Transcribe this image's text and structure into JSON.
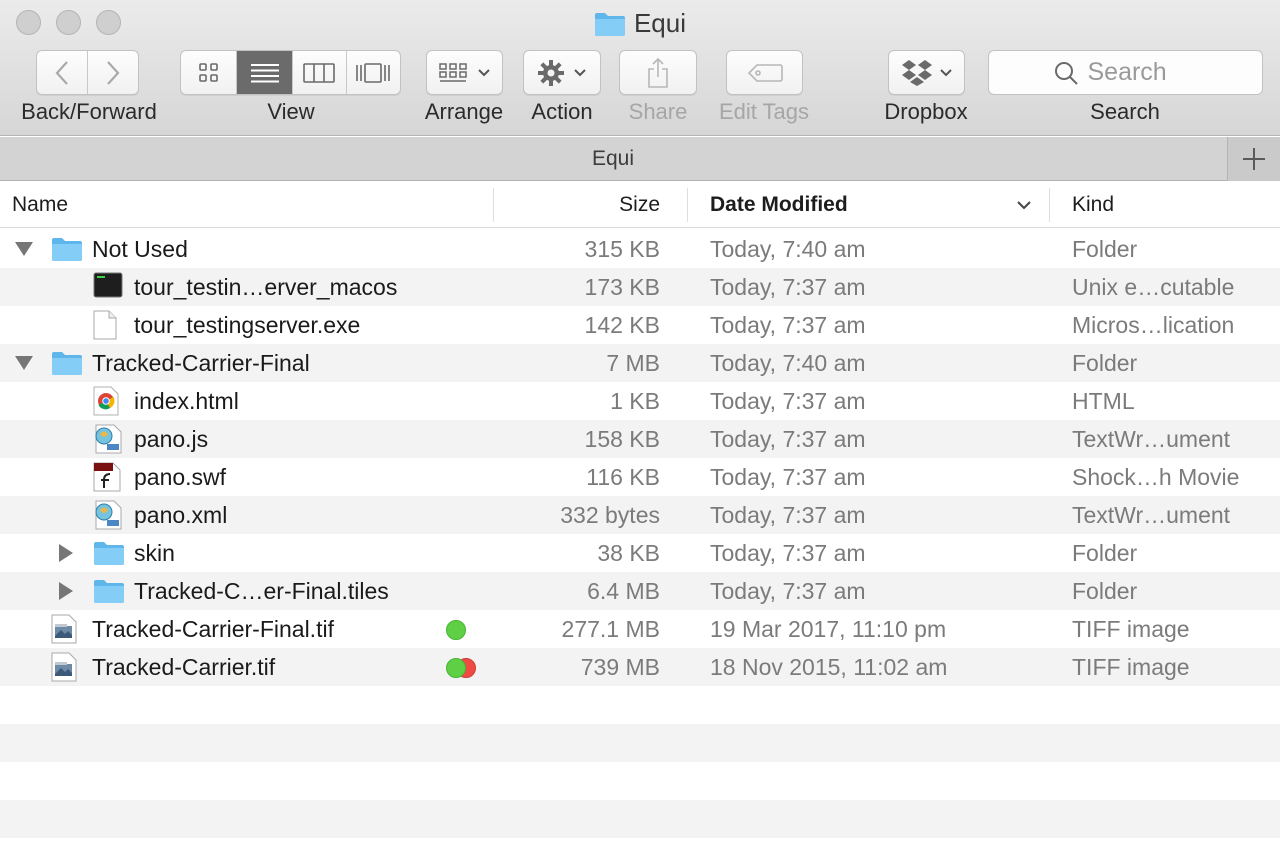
{
  "window": {
    "title": "Equi"
  },
  "toolbar": {
    "back_forward_label": "Back/Forward",
    "view_label": "View",
    "arrange_label": "Arrange",
    "action_label": "Action",
    "share_label": "Share",
    "edit_tags_label": "Edit Tags",
    "dropbox_label": "Dropbox",
    "search_label": "Search",
    "search_placeholder": "Search"
  },
  "tabbar": {
    "title": "Equi"
  },
  "columns": {
    "name": "Name",
    "size": "Size",
    "date": "Date Modified",
    "kind": "Kind"
  },
  "colors": {
    "folder": "#6cc3f4",
    "tag_green": "#5fcf46",
    "tag_red": "#f04a44"
  },
  "rows": [
    {
      "name": "Not Used",
      "size": "315 KB",
      "date": "Today, 7:40 am",
      "kind": "Folder",
      "icon": "folder-icon",
      "level": 0,
      "disclosure": "open"
    },
    {
      "name": "tour_testin…erver_macos",
      "size": "173 KB",
      "date": "Today, 7:37 am",
      "kind": "Unix e…cutable",
      "icon": "terminal-icon",
      "level": 1
    },
    {
      "name": "tour_testingserver.exe",
      "size": "142 KB",
      "date": "Today, 7:37 am",
      "kind": "Micros…lication",
      "icon": "blank-document-icon",
      "level": 1
    },
    {
      "name": "Tracked-Carrier-Final",
      "size": "7 MB",
      "date": "Today, 7:40 am",
      "kind": "Folder",
      "icon": "folder-icon",
      "level": 0,
      "disclosure": "open"
    },
    {
      "name": "index.html",
      "size": "1 KB",
      "date": "Today, 7:37 am",
      "kind": "HTML",
      "icon": "chrome-icon",
      "level": 1
    },
    {
      "name": "pano.js",
      "size": "158 KB",
      "date": "Today, 7:37 am",
      "kind": "TextWr…ument",
      "icon": "textwrangler-document-icon",
      "level": 1
    },
    {
      "name": "pano.swf",
      "size": "116 KB",
      "date": "Today, 7:37 am",
      "kind": "Shock…h Movie",
      "icon": "swf-document-icon",
      "level": 1
    },
    {
      "name": "pano.xml",
      "size": "332 bytes",
      "date": "Today, 7:37 am",
      "kind": "TextWr…ument",
      "icon": "textwrangler-document-icon",
      "level": 1
    },
    {
      "name": "skin",
      "size": "38 KB",
      "date": "Today, 7:37 am",
      "kind": "Folder",
      "icon": "folder-icon",
      "level": 1,
      "disclosure": "closed"
    },
    {
      "name": "Tracked-C…er-Final.tiles",
      "size": "6.4 MB",
      "date": "Today, 7:37 am",
      "kind": "Folder",
      "icon": "folder-icon",
      "level": 1,
      "disclosure": "closed"
    },
    {
      "name": "Tracked-Carrier-Final.tif",
      "size": "277.1 MB",
      "date": "19 Mar 2017, 11:10 pm",
      "kind": "TIFF image",
      "icon": "tiff-document-icon",
      "level": 0,
      "tags": [
        "green"
      ]
    },
    {
      "name": "Tracked-Carrier.tif",
      "size": "739 MB",
      "date": "18 Nov 2015, 11:02 am",
      "kind": "TIFF image",
      "icon": "tiff-document-icon",
      "level": 0,
      "tags": [
        "green",
        "red"
      ]
    }
  ]
}
